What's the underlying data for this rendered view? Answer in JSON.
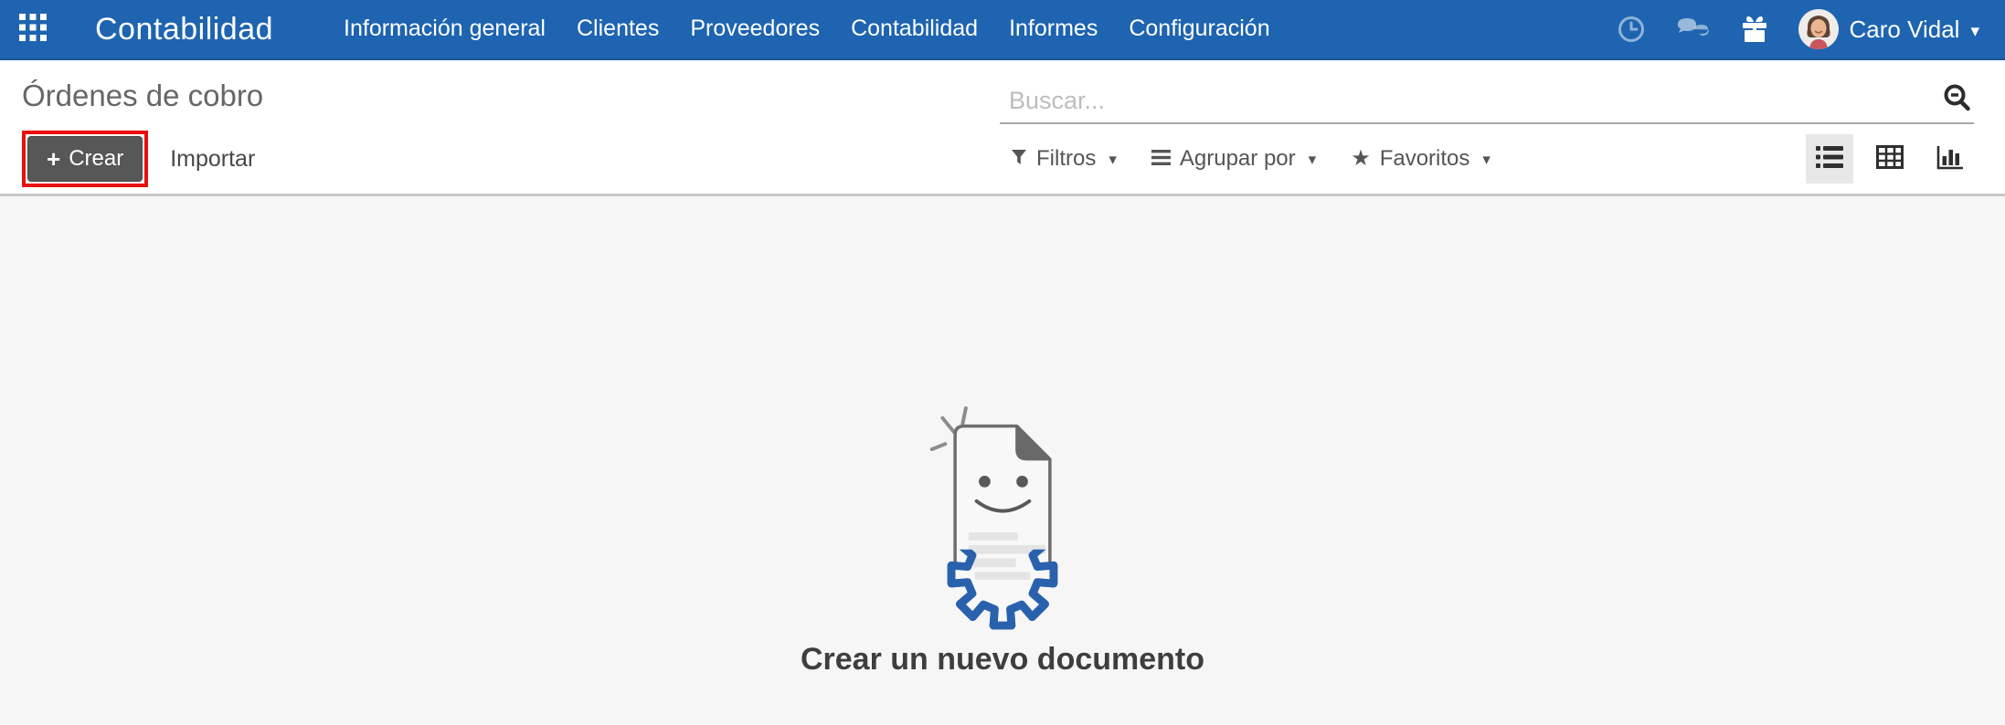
{
  "nav": {
    "brand": "Contabilidad",
    "items": [
      "Información general",
      "Clientes",
      "Proveedores",
      "Contabilidad",
      "Informes",
      "Configuración"
    ],
    "user_name": "Caro Vidal"
  },
  "page": {
    "title": "Órdenes de cobro"
  },
  "toolbar": {
    "create_plus": "+",
    "create_label": "Crear",
    "import_label": "Importar"
  },
  "search": {
    "placeholder": "Buscar..."
  },
  "filter_bar": {
    "filters_label": "Filtros",
    "group_by_label": "Agrupar por",
    "favorites_label": "Favoritos"
  },
  "icons": {
    "caret": "▾",
    "star": "★",
    "apps": "apps-grid-icon",
    "clock": "clock-icon",
    "chat": "chat-bubbles-icon",
    "gift": "gift-icon",
    "search": "magnifier-icon",
    "filter": "funnel-icon",
    "group_by": "list-lines-icon",
    "views": [
      "list-view-icon",
      "table-view-icon",
      "bar-chart-view-icon"
    ]
  },
  "empty_state": {
    "message": "Crear un nuevo documento"
  },
  "colors": {
    "nav_bg": "#1e64b0",
    "highlight_red": "#e8100c",
    "gear_blue": "#2a61ad",
    "button_bg": "#575757",
    "active_view_bg": "#e8e8e8",
    "content_bg": "#f6f6f6",
    "divider": "#c9c9c9"
  }
}
